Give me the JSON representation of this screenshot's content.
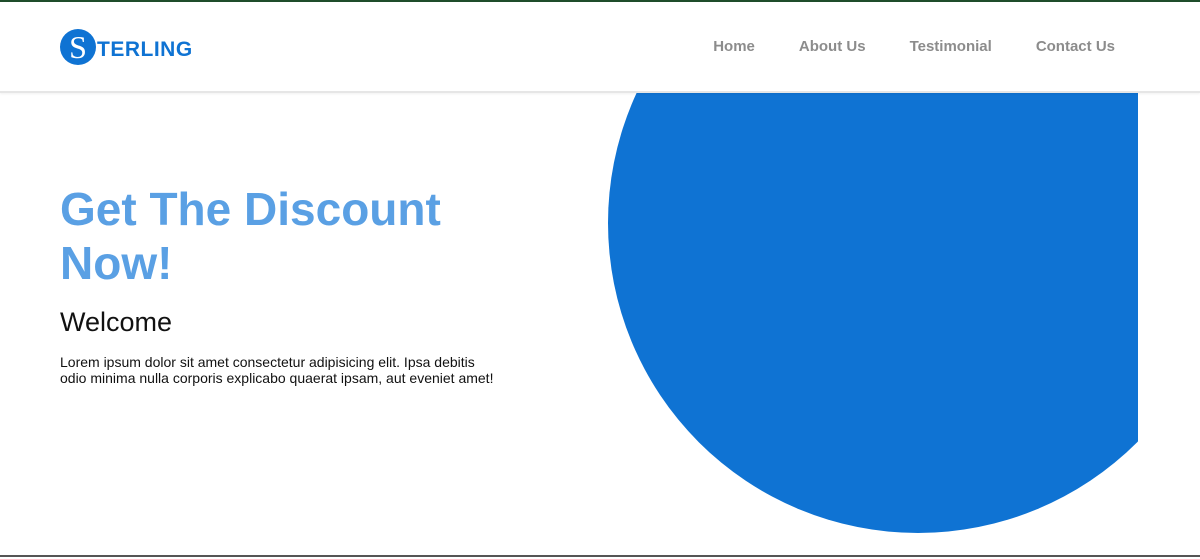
{
  "brand": {
    "logo_letter": "S",
    "logo_text": "TERLING",
    "color": "#0f73d3"
  },
  "nav": {
    "items": [
      {
        "label": "Home"
      },
      {
        "label": "About Us"
      },
      {
        "label": "Testimonial"
      },
      {
        "label": "Contact Us"
      }
    ],
    "color": "#8c8c8c"
  },
  "hero": {
    "title": "Get The Discount Now!",
    "subtitle": "Welcome",
    "text": "Lorem ipsum dolor sit amet consectetur adipisicing elit. Ipsa debitis odio minima nulla corporis explicabo quaerat ipsam, aut eveniet amet!",
    "title_color": "#5aa0e4"
  },
  "decor": {
    "circle_color": "#0f73d3"
  }
}
